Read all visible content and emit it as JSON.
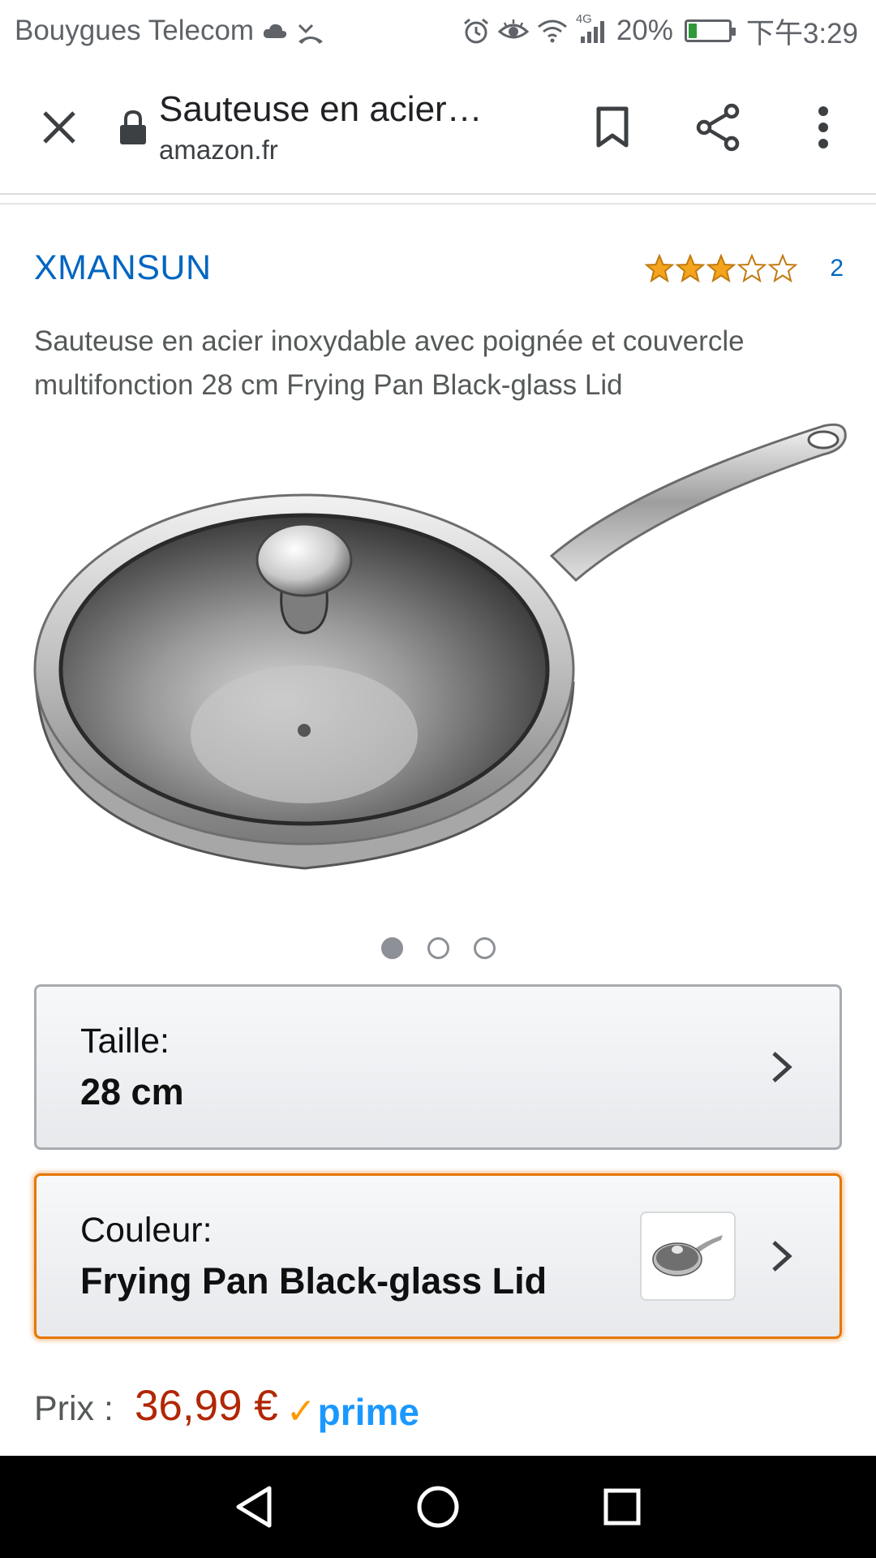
{
  "status_bar": {
    "carrier": "Bouygues Telecom",
    "network": "4G",
    "battery": "20%",
    "battery_level": 0.2,
    "time": "下午3:29"
  },
  "browser": {
    "page_title": "Sauteuse en acier…",
    "url": "amazon.fr"
  },
  "product": {
    "brand": "XMANSUN",
    "rating_stars": 3,
    "rating_max": 5,
    "rating_count": "2",
    "title": "Sauteuse en acier inoxydable avec poignée et couvercle multifonction 28 cm Frying Pan Black-glass Lid",
    "image_count": 3,
    "active_image": 0
  },
  "size_selector": {
    "label": "Taille:",
    "value": "28 cm"
  },
  "color_selector": {
    "label": "Couleur:",
    "value": "Frying Pan Black-glass Lid"
  },
  "price": {
    "label": "Prix :",
    "value": "36,99 €",
    "prime_check": "✓",
    "prime_label": "prime"
  },
  "colors": {
    "link": "#0066c0",
    "price": "#b12704",
    "star": "#f4a41d",
    "highlight_border": "#e77600",
    "prime_blue": "#1a98ff",
    "prime_orange": "#ff9900"
  },
  "icons": {
    "status_left": [
      "cloud-icon",
      "missed-call-icon"
    ],
    "status_right": [
      "alarm-icon",
      "eye-icon",
      "wifi-icon",
      "signal-icon",
      "battery-icon"
    ],
    "browser": [
      "close-icon",
      "lock-icon",
      "bookmark-icon",
      "share-icon",
      "more-vert-icon"
    ],
    "nav": [
      "back-icon",
      "home-icon",
      "recents-icon"
    ]
  }
}
